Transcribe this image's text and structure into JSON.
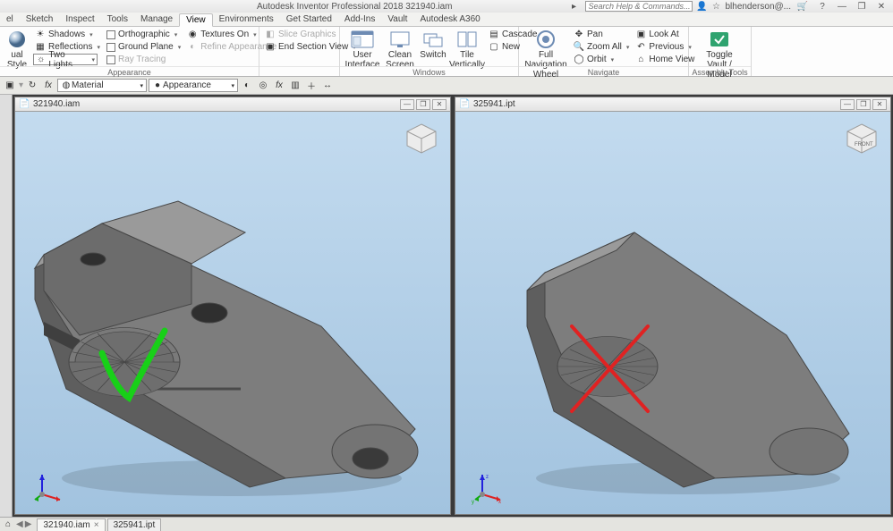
{
  "app": {
    "title": "Autodesk Inventor Professional 2018   321940.iam",
    "search_placeholder": "Search Help & Commands...",
    "user": "blhenderson@..."
  },
  "menutabs": {
    "items": [
      "el",
      "Sketch",
      "Inspect",
      "Tools",
      "Manage",
      "View",
      "Environments",
      "Get Started",
      "Add-Ins",
      "Vault",
      "Autodesk A360"
    ],
    "active": 5
  },
  "ribbon": {
    "visual_style": "ual Style",
    "shadows": "Shadows",
    "reflections": "Reflections",
    "two_lights": "Two Lights",
    "orthographic": "Orthographic",
    "ground_plane": "Ground Plane",
    "ray_tracing": "Ray Tracing",
    "textures_on": "Textures On",
    "refine": "Refine Appearance",
    "appearance_title": "Appearance",
    "slice_graphics": "Slice Graphics",
    "end_section": "End Section View",
    "user_interface": "User\nInterface",
    "clean_screen": "Clean\nScreen",
    "switch": "Switch",
    "tile_vertically": "Tile Vertically",
    "cascade": "Cascade",
    "new": "New",
    "windows_title": "Windows",
    "full_nav": "Full Navigation\nWheel",
    "pan": "Pan",
    "zoom_all": "Zoom All",
    "orbit": "Orbit",
    "look_at": "Look At",
    "previous": "Previous",
    "home_view": "Home View",
    "navigate_title": "Navigate",
    "toggle_vault": "Toggle\nVault / Model",
    "assembly_tools_title": "Assembly Tools"
  },
  "quickbar": {
    "material": "Material",
    "appearance": "Appearance"
  },
  "windows": {
    "left": {
      "title": "321940.iam"
    },
    "right": {
      "title": "325941.ipt"
    }
  },
  "tabs": {
    "items": [
      "321940.iam",
      "325941.ipt"
    ]
  }
}
